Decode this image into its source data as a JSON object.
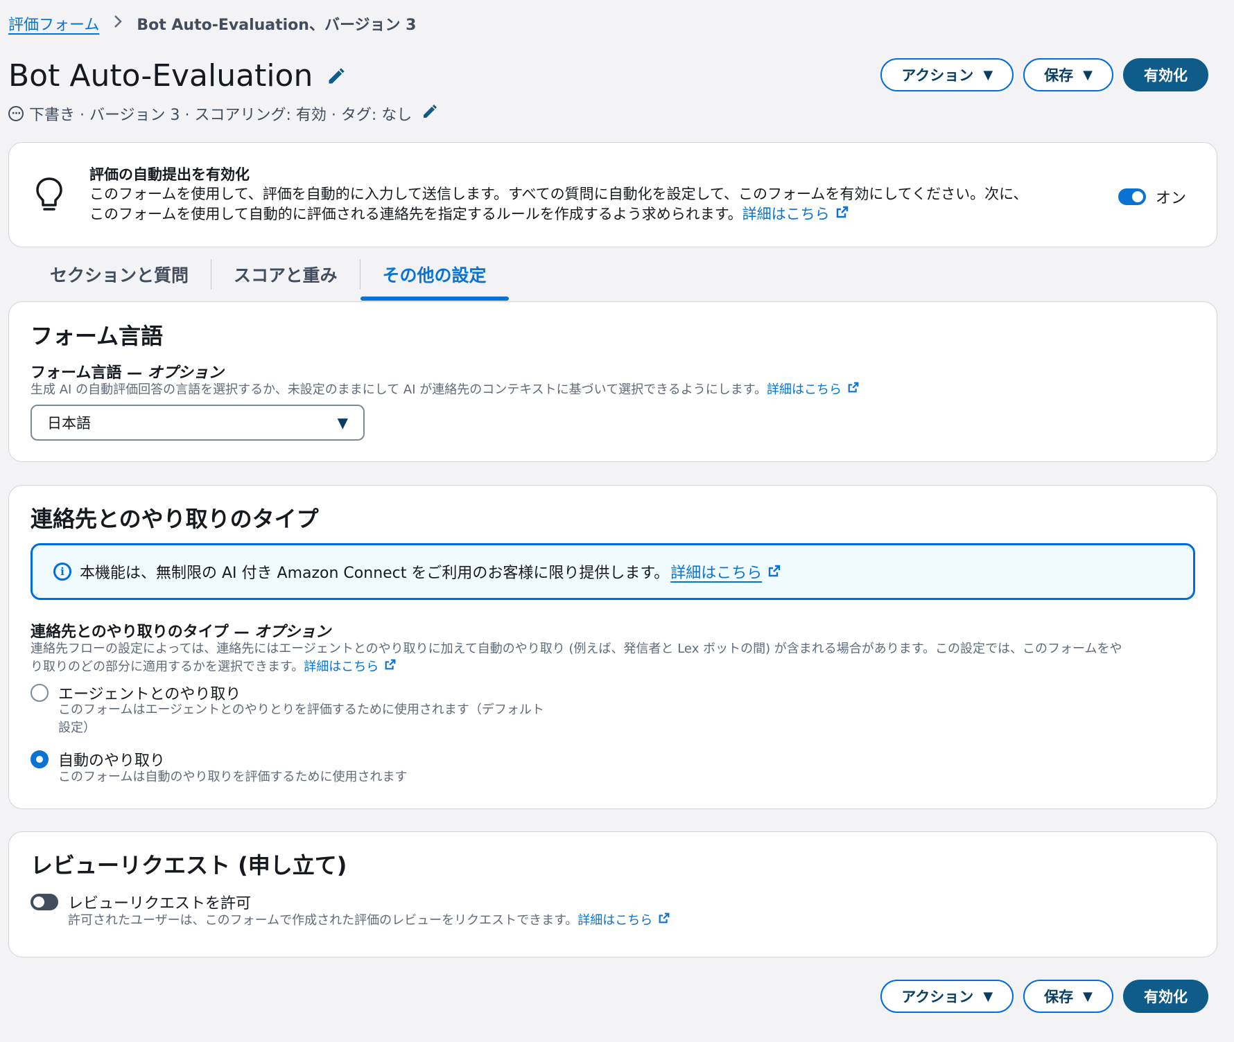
{
  "breadcrumb": {
    "parent": "評価フォーム",
    "separator": ">",
    "current": "Bot Auto-Evaluation、バージョン 3"
  },
  "header": {
    "title": "Bot Auto-Evaluation",
    "meta": "下書き · バージョン 3 · スコアリング: 有効 · タグ: なし"
  },
  "actions": {
    "action": "アクション",
    "save": "保存",
    "activate": "有効化"
  },
  "auto_submit": {
    "title": "評価の自動提出を有効化",
    "line1": "このフォームを使用して、評価を自動的に入力して送信します。すべての質問に自動化を設定して、このフォームを有効にしてください。次に、",
    "line2": "このフォームを使用して自動的に評価される連絡先を指定するルールを作成するよう求められます。",
    "link": "詳細はこちら",
    "toggle_label": "オン",
    "enabled": true
  },
  "tabs": [
    {
      "label": "セクションと質問"
    },
    {
      "label": "スコアと重み"
    },
    {
      "label": "その他の設定"
    }
  ],
  "form_language": {
    "heading": "フォーム言語",
    "label_main": "フォーム言語 — ",
    "label_opt": "オプション",
    "description": "生成 AI の自動評価回答の言語を選択するか、未設定のままにして AI が連絡先のコンテキストに基づいて選択できるようにします。",
    "link": "詳細はこちら",
    "selected": "日本語"
  },
  "interaction_type": {
    "heading": "連絡先とのやり取りのタイプ",
    "info": "本機能は、無制限の AI 付き Amazon Connect をご利用のお客様に限り提供します。",
    "info_link": "詳細はこちら",
    "label_main": "連絡先とのやり取りのタイプ — ",
    "label_opt": "オプション",
    "desc_line1": "連絡先フローの設定によっては、連絡先にはエージェントとのやり取りに加えて自動のやり取り (例えば、発信者と Lex ボットの間) が含まれる場合があります。この設定では、このフォームをや",
    "desc_line2": "り取りのどの部分に適用するかを選択できます。",
    "link": "詳細はこちら",
    "options": [
      {
        "label": "エージェントとのやり取り",
        "desc1": "このフォームはエージェントとのやりとりを評価するために使用されます（デフォルト",
        "desc2": "設定）",
        "selected": false
      },
      {
        "label": "自動のやり取り",
        "desc1": "このフォームは自動のやり取りを評価するために使用されます",
        "desc2": "",
        "selected": true
      }
    ]
  },
  "review": {
    "heading": "レビューリクエスト (申し立て)",
    "toggle_label": "レビューリクエストを許可",
    "description": "許可されたユーザーは、このフォームで作成された評価のレビューをリクエストできます。",
    "link": "詳細はこちら",
    "enabled": false
  }
}
